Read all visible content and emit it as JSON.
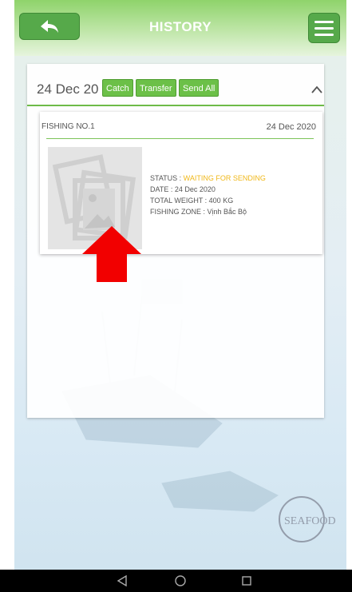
{
  "header": {
    "title": "HISTORY",
    "back_icon": "back-arrow-icon",
    "menu_icon": "hamburger-menu-icon"
  },
  "history_group": {
    "date": "24 Dec 20",
    "buttons": [
      "Catch",
      "Transfer",
      "Send All"
    ],
    "collapse_icon": "chevron-up-icon"
  },
  "record": {
    "name": "FISHING NO.1",
    "date": "24 Dec 2020",
    "status_label": "STATUS : ",
    "status_value": "WAITING FOR SENDING",
    "date_line": "DATE : 24 Dec 2020",
    "weight_line": "TOTAL WEIGHT : 400 KG",
    "zone_line": "FISHING ZONE : Vịnh Bắc Bộ"
  },
  "colors": {
    "accent": "#56a94a",
    "pill": "#6cc048",
    "status": "#f0b81a",
    "arrow": "#f20000"
  },
  "navbar": {
    "icons": [
      "back-triangle-icon",
      "home-circle-icon",
      "recents-square-icon"
    ]
  }
}
